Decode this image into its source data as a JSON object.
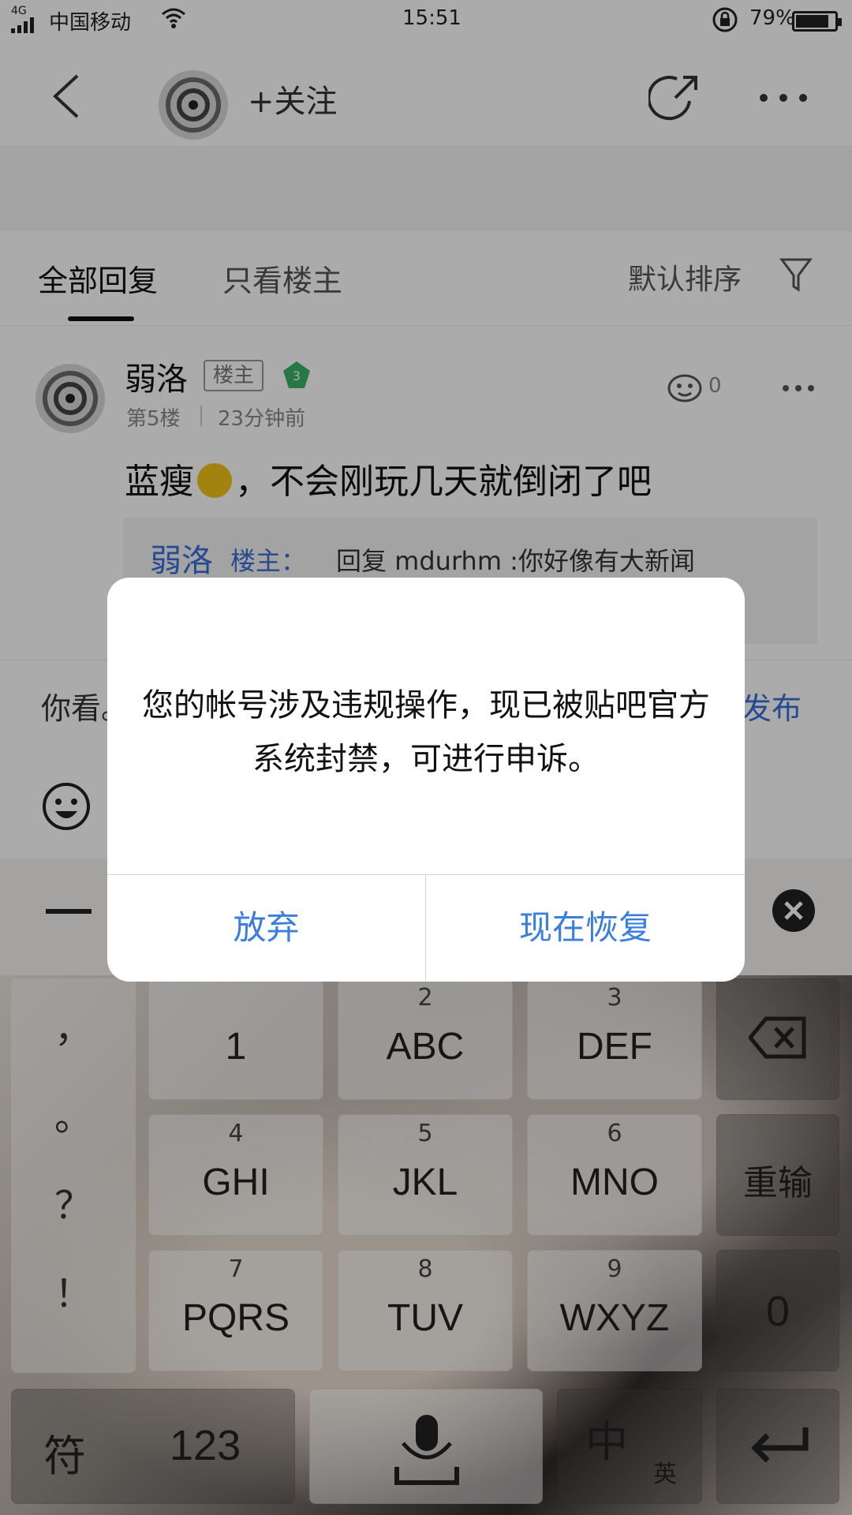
{
  "status_bar": {
    "network": "4G",
    "carrier": "中国移动",
    "time": "15:51",
    "battery": "79%"
  },
  "header": {
    "follow_label": "+关注"
  },
  "tabs": {
    "all_replies": "全部回复",
    "owner_only": "只看楼主",
    "sort": "默认排序"
  },
  "post": {
    "username": "弱洛",
    "badge": "楼主",
    "level": "3",
    "floor": "第5楼",
    "time_ago": "23分钟前",
    "like_count": "0",
    "text_before_emoji": "蓝瘦",
    "text_after_emoji": "，不会刚玩几天就倒闭了吧",
    "quote": {
      "name": "弱洛",
      "role": "楼主：",
      "text": "回复 mdurhm :你好像有大新闻"
    }
  },
  "reply_bar": {
    "input_text": "你看。",
    "publish": "发布"
  },
  "keyboard": {
    "punctuation": [
      "，",
      "。",
      "？",
      "！"
    ],
    "keys": [
      {
        "num": "",
        "letters": "1"
      },
      {
        "num": "2",
        "letters": "ABC"
      },
      {
        "num": "3",
        "letters": "DEF"
      },
      {
        "num": "4",
        "letters": "GHI"
      },
      {
        "num": "5",
        "letters": "JKL"
      },
      {
        "num": "6",
        "letters": "MNO"
      },
      {
        "num": "7",
        "letters": "PQRS"
      },
      {
        "num": "8",
        "letters": "TUV"
      },
      {
        "num": "9",
        "letters": "WXYZ"
      }
    ],
    "retype": "重输",
    "zero": "0",
    "symbols": "符",
    "numbers": "123",
    "lang_zh": "中",
    "lang_en": "英"
  },
  "dialog": {
    "message": "您的帐号涉及违规操作，现已被贴吧官方系统封禁，可进行申诉。",
    "cancel": "放弃",
    "confirm": "现在恢复",
    "button_color": "#3a7fe0"
  }
}
